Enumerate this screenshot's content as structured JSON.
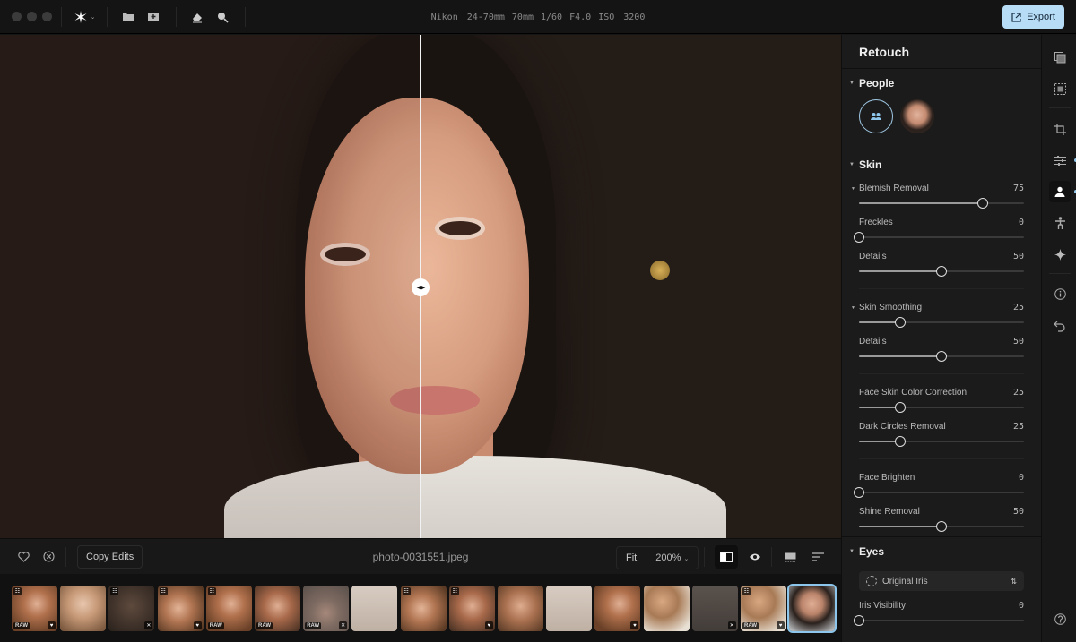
{
  "window": {
    "traffic_lights": [
      "close",
      "minimize",
      "zoom"
    ]
  },
  "toolbar": {
    "tools": [
      {
        "name": "ai-sparkle-menu",
        "icon": "sparkle-icon",
        "has_dropdown": true
      },
      {
        "name": "open-folder",
        "icon": "folder-icon"
      },
      {
        "name": "import",
        "icon": "import-icon"
      },
      {
        "name": "eraser",
        "icon": "eraser-icon"
      },
      {
        "name": "zoom-tool",
        "icon": "magnifier-icon"
      }
    ],
    "exif": {
      "lens": "Nikon 24-70mm",
      "focal_length": "70mm",
      "shutter": "1/60",
      "aperture": "F4.0",
      "iso": "ISO 3200"
    },
    "export_label": "Export",
    "accent_color": "#b7dcf6"
  },
  "canvas": {
    "compare_split": 0.5,
    "compare_mode": "before-after split"
  },
  "bottombar": {
    "favorite_icon": "heart-icon",
    "reject_icon": "reject-circle-icon",
    "copy_edits_label": "Copy Edits",
    "filename": "photo-0031551.jpeg",
    "fit_label": "Fit",
    "zoom_level": "200%",
    "view_icons": [
      "split-compare-icon",
      "eye-icon",
      "image-info-icon",
      "sort-icon"
    ]
  },
  "filmstrip": {
    "thumbnails": [
      {
        "raw": true,
        "fav": true,
        "edited": true,
        "reject": false,
        "tone": "warm-curly"
      },
      {
        "raw": false,
        "fav": false,
        "edited": false,
        "reject": false,
        "tone": "warm-light"
      },
      {
        "raw": false,
        "fav": false,
        "edited": true,
        "reject": true,
        "tone": "dark-dim"
      },
      {
        "raw": false,
        "fav": true,
        "edited": true,
        "reject": false,
        "tone": "warm-close"
      },
      {
        "raw": true,
        "fav": false,
        "edited": true,
        "reject": false,
        "tone": "warm-curly"
      },
      {
        "raw": true,
        "fav": false,
        "edited": false,
        "reject": false,
        "tone": "warm-red"
      },
      {
        "raw": true,
        "fav": false,
        "edited": false,
        "reject": true,
        "tone": "grey-hood"
      },
      {
        "raw": false,
        "fav": false,
        "edited": false,
        "reject": false,
        "tone": "light-full"
      },
      {
        "raw": false,
        "fav": false,
        "edited": true,
        "reject": false,
        "tone": "warm-close"
      },
      {
        "raw": false,
        "fav": true,
        "edited": true,
        "reject": false,
        "tone": "warm-red"
      },
      {
        "raw": false,
        "fav": false,
        "edited": false,
        "reject": false,
        "tone": "warm-lips"
      },
      {
        "raw": false,
        "fav": false,
        "edited": false,
        "reject": false,
        "tone": "light-full"
      },
      {
        "raw": false,
        "fav": true,
        "edited": false,
        "reject": false,
        "tone": "warm-curly"
      },
      {
        "raw": false,
        "fav": false,
        "edited": false,
        "reject": false,
        "tone": "warm-back"
      },
      {
        "raw": false,
        "fav": false,
        "edited": false,
        "reject": true,
        "tone": "grey-dim"
      },
      {
        "raw": true,
        "fav": true,
        "edited": true,
        "reject": false,
        "tone": "warm-back"
      },
      {
        "raw": false,
        "fav": false,
        "edited": false,
        "reject": false,
        "tone": "current",
        "selected": true
      }
    ]
  },
  "panel": {
    "title": "Retouch",
    "people": {
      "label": "People",
      "items": [
        {
          "type": "group",
          "icon": "people-group-icon",
          "selected": true
        },
        {
          "type": "face",
          "icon": "face-avatar"
        }
      ]
    },
    "skin": {
      "label": "Skin",
      "groups": [
        [
          {
            "label": "Blemish Removal",
            "value": 75,
            "collapsible": true
          },
          {
            "label": "Freckles",
            "value": 0
          },
          {
            "label": "Details",
            "value": 50
          }
        ],
        [
          {
            "label": "Skin Smoothing",
            "value": 25,
            "collapsible": true
          },
          {
            "label": "Details",
            "value": 50
          }
        ],
        [
          {
            "label": "Face Skin Color Correction",
            "value": 25
          },
          {
            "label": "Dark Circles Removal",
            "value": 25
          }
        ],
        [
          {
            "label": "Face Brighten",
            "value": 0
          },
          {
            "label": "Shine Removal",
            "value": 50
          }
        ]
      ]
    },
    "eyes": {
      "label": "Eyes",
      "iris_select": "Original Iris",
      "sliders": [
        {
          "label": "Iris Visibility",
          "value": 0
        }
      ]
    }
  },
  "rail": {
    "items": [
      {
        "name": "presets",
        "icon": "layers-icon"
      },
      {
        "name": "masking",
        "icon": "mask-select-icon"
      },
      {
        "name": "crop",
        "icon": "crop-icon"
      },
      {
        "name": "adjust",
        "icon": "sliders-icon",
        "dot": true
      },
      {
        "name": "retouch",
        "icon": "person-icon",
        "active": true,
        "dot": true
      },
      {
        "name": "body",
        "icon": "body-icon"
      },
      {
        "name": "ai-enhance",
        "icon": "sparkle-icon"
      },
      {
        "name": "info",
        "icon": "info-icon"
      },
      {
        "name": "history",
        "icon": "undo-icon"
      },
      {
        "name": "help",
        "icon": "help-icon"
      }
    ]
  }
}
